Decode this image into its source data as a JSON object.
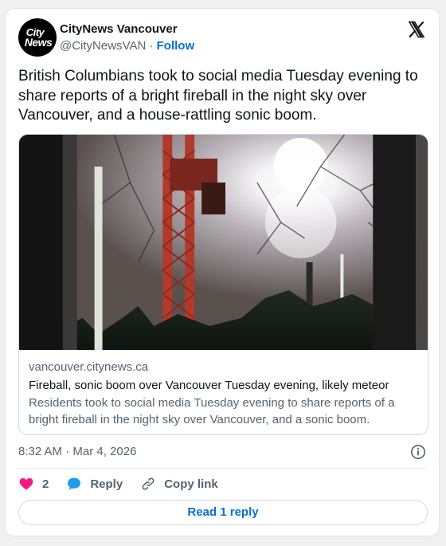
{
  "colors": {
    "link_blue": "#006fd6",
    "secondary_text": "#536471",
    "heart_pink": "#f91880",
    "reply_blue": "#1d9bf0"
  },
  "author": {
    "logo_text_line1": "City",
    "logo_text_line2": "News",
    "display_name": "CityNews Vancouver",
    "handle": "@CityNewsVAN",
    "separator": "·",
    "follow_label": "Follow"
  },
  "icons": {
    "platform": "x-logo-icon",
    "info": "info-icon",
    "like": "heart-icon",
    "reply": "reply-bubble-icon",
    "copy_link": "link-icon"
  },
  "tweet": {
    "text": "British Columbians took to social media Tuesday evening to share reports of a bright fireball in the night sky over Vancouver, and a house-rattling sonic boom."
  },
  "link_card": {
    "domain": "vancouver.citynews.ca",
    "title": "Fireball, sonic boom over Vancouver Tuesday evening, likely meteor",
    "description": "Residents took to social media Tuesday evening to share reports of a bright fireball in the night sky over Vancouver, and a sonic boom."
  },
  "meta": {
    "timestamp": "8:32 AM · Mar 4, 2026"
  },
  "actions": {
    "like_count": "2",
    "reply_label": "Reply",
    "copy_link_label": "Copy link"
  },
  "read_replies_label": "Read 1 reply"
}
